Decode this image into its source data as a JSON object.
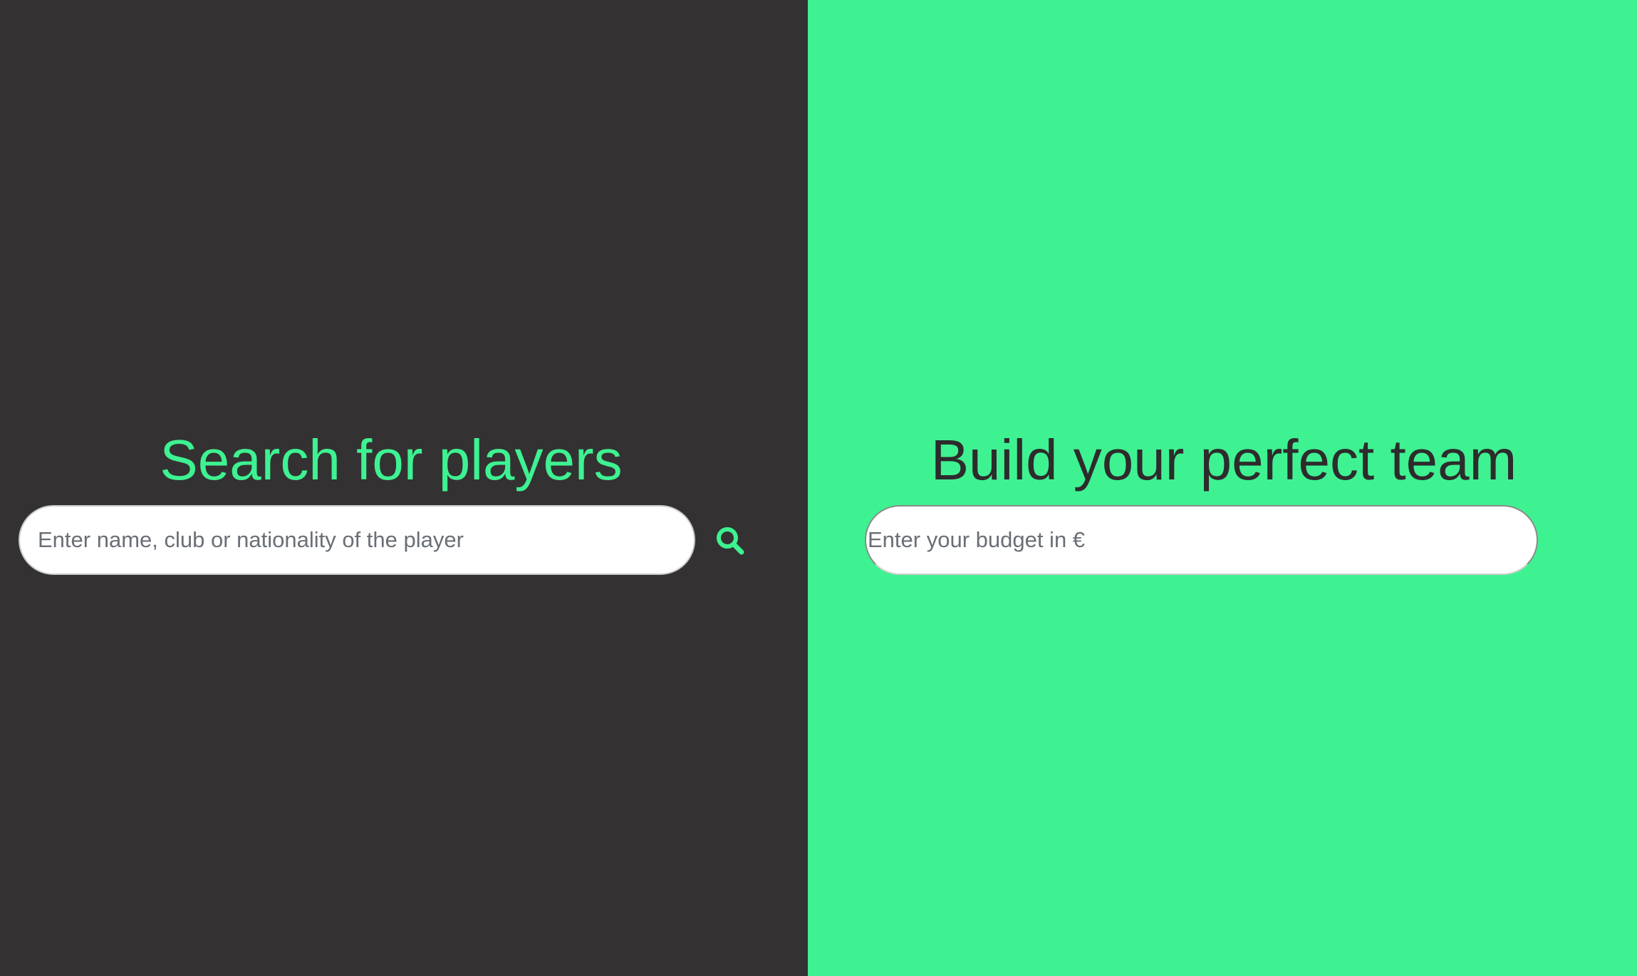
{
  "left_panel": {
    "heading": "Search for players",
    "search_placeholder": "Enter name, club or nationality of the player",
    "search_icon": "search-icon",
    "background_color": "#333132",
    "accent_color": "#3ef291"
  },
  "right_panel": {
    "heading": "Build your perfect team",
    "search_placeholder": "Enter your budget in €",
    "search_icon": "search-icon",
    "background_color": "#3ef291",
    "text_color": "#2d2b2c"
  }
}
